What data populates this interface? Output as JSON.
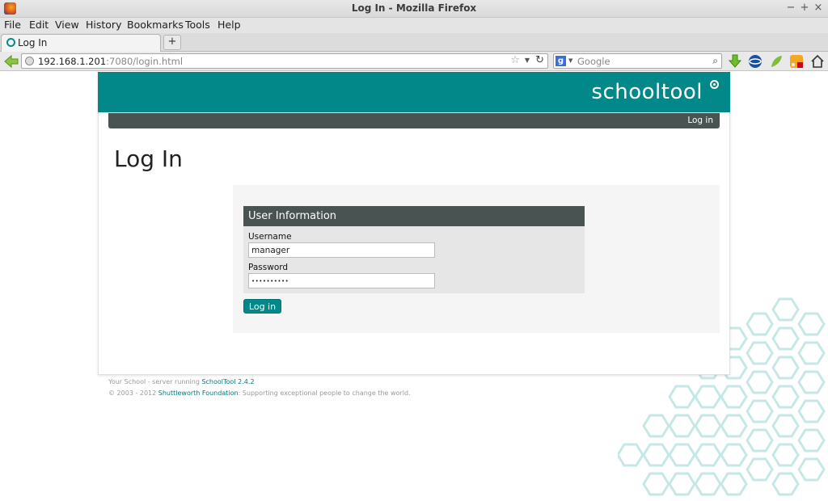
{
  "window": {
    "title": "Log In - Mozilla Firefox",
    "controls": [
      "−",
      "+",
      "×"
    ]
  },
  "menu": [
    "File",
    "Edit",
    "View",
    "History",
    "Bookmarks",
    "Tools",
    "Help"
  ],
  "tabs": [
    {
      "label": "Log In"
    }
  ],
  "new_tab_label": "+",
  "navbar": {
    "url_host": "192.168.1.201",
    "url_rest": ":7080/login.html",
    "search_placeholder": "Google"
  },
  "site": {
    "brand": "schooltool",
    "nav_login": "Log in",
    "page_title": "Log In",
    "accent": "#03888a",
    "dark": "#485352"
  },
  "form": {
    "legend": "User Information",
    "username_label": "Username",
    "username_value": "manager",
    "password_label": "Password",
    "password_value": "••••••••••",
    "submit_label": "Log in"
  },
  "footer": {
    "line1_prefix": "Your School - server running ",
    "line1_link": "SchoolTool 2.4.2",
    "line2_prefix": "© 2003 - 2012 ",
    "line2_link": "Shuttleworth Foundation",
    "line2_suffix": ": Supporting exceptional people to change the world."
  }
}
